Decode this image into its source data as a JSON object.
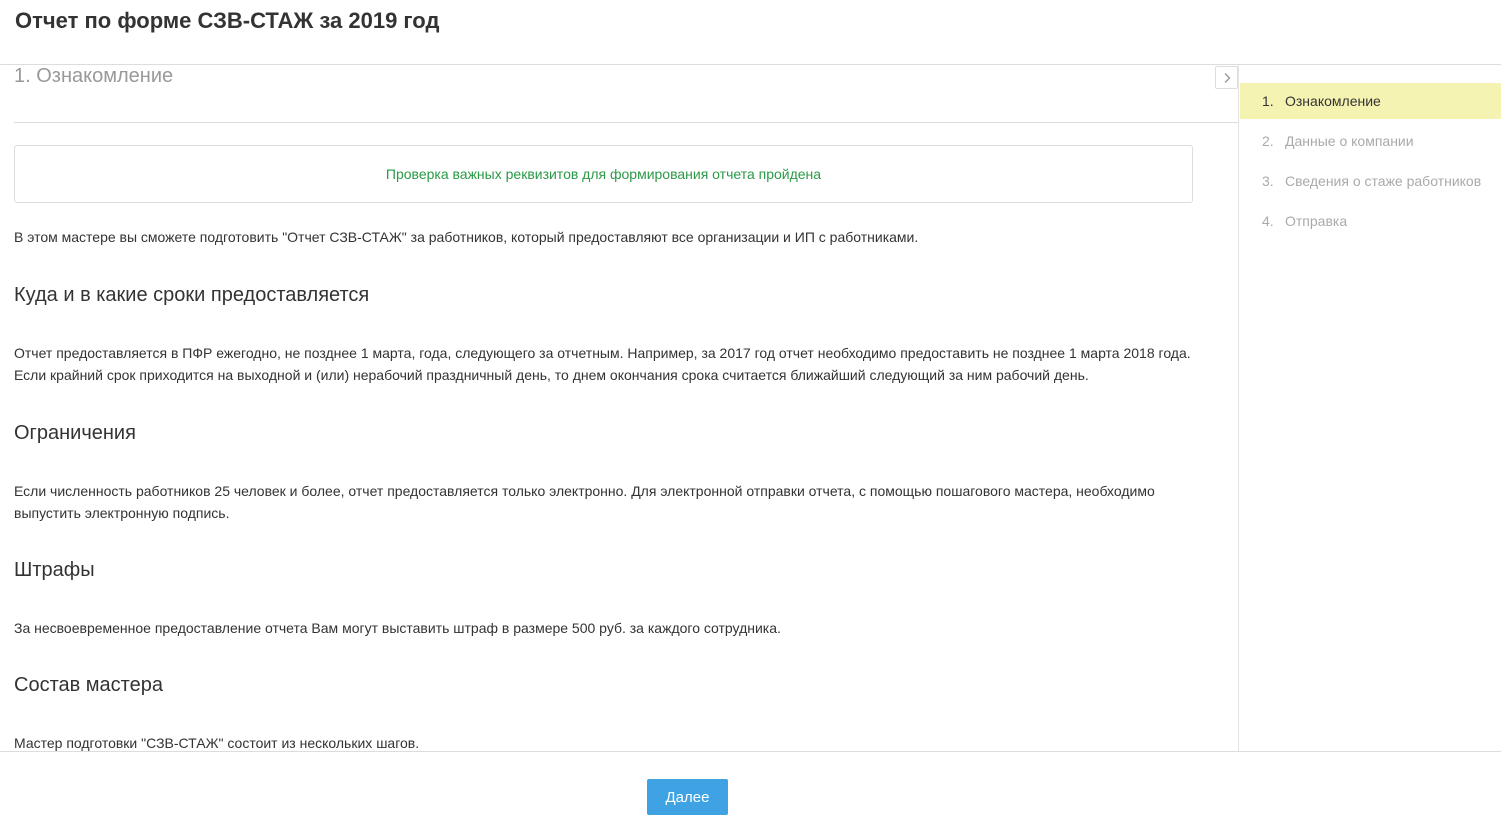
{
  "header": {
    "title": "Отчет по форме СЗВ-СТАЖ за 2019 год"
  },
  "step": {
    "title": "1. Ознакомление"
  },
  "check": {
    "message": "Проверка важных реквизитов для формирования отчета пройдена"
  },
  "intro": "В этом мастере вы сможете подготовить \"Отчет СЗВ-СТАЖ\" за работников, который предоставляют все организации и ИП с работниками.",
  "sections": [
    {
      "heading": "Куда и в какие сроки предоставляется",
      "text": "Отчет предоставляется в ПФР ежегодно, не позднее 1 марта, года, следующего за отчетным. Например, за 2017 год отчет необходимо предоставить не позднее 1 марта 2018 года. Если крайний срок приходится на выходной и (или) нерабочий праздничный день, то днем окончания срока считается ближайший следующий за ним рабочий день."
    },
    {
      "heading": "Ограничения",
      "text": "Если численность работников 25 человек и более, отчет предоставляется только электронно. Для электронной отправки отчета, с помощью пошагового мастера, необходимо выпустить электронную подпись."
    },
    {
      "heading": "Штрафы",
      "text": "За несвоевременное предоставление отчета Вам могут выставить штраф в размере 500 руб. за каждого сотрудника."
    },
    {
      "heading": "Состав мастера",
      "text": "Мастер подготовки \"СЗВ-СТАЖ\" состоит из нескольких шагов."
    }
  ],
  "sidebar": {
    "items": [
      {
        "num": "1.",
        "label": "Ознакомление"
      },
      {
        "num": "2.",
        "label": "Данные о компании"
      },
      {
        "num": "3.",
        "label": "Сведения о стаже работников"
      },
      {
        "num": "4.",
        "label": "Отправка"
      }
    ]
  },
  "footer": {
    "next_label": "Далее"
  },
  "icons": {
    "collapse": "chevron-right-icon"
  },
  "colors": {
    "accent": "#3ea2e3",
    "success": "#2a9a47",
    "active_step": "#f5f3b1"
  }
}
